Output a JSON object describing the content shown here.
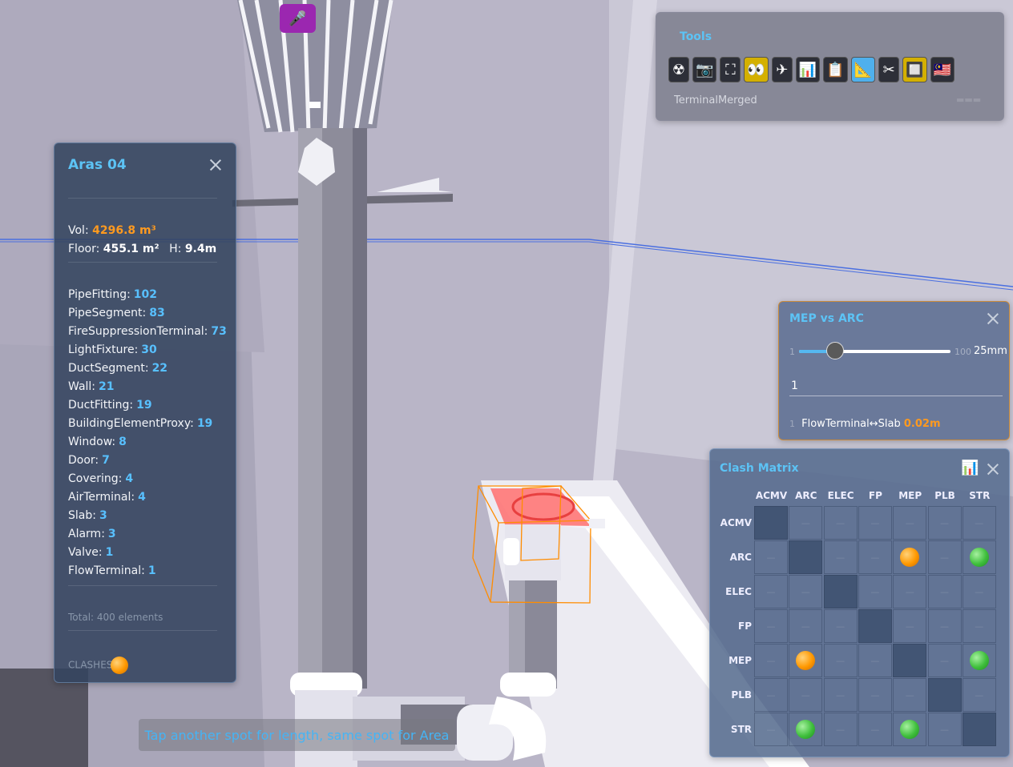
{
  "mic": {
    "icon": "🎤"
  },
  "info": {
    "title": "Aras 04",
    "vol_label": "Vol:",
    "vol_value": "4296.8 m³",
    "floor_label": "Floor:",
    "floor_value": "455.1 m²",
    "h_label": "H:",
    "h_value": "9.4m",
    "counts": [
      {
        "label": "PipeFitting:",
        "value": "102"
      },
      {
        "label": "PipeSegment:",
        "value": "83"
      },
      {
        "label": "FireSuppressionTerminal:",
        "value": "73"
      },
      {
        "label": "LightFixture:",
        "value": "30"
      },
      {
        "label": "DuctSegment:",
        "value": "22"
      },
      {
        "label": "Wall:",
        "value": "21"
      },
      {
        "label": "DuctFitting:",
        "value": "19"
      },
      {
        "label": "BuildingElementProxy:",
        "value": "19"
      },
      {
        "label": "Window:",
        "value": "8"
      },
      {
        "label": "Door:",
        "value": "7"
      },
      {
        "label": "Covering:",
        "value": "4"
      },
      {
        "label": "AirTerminal:",
        "value": "4"
      },
      {
        "label": "Slab:",
        "value": "3"
      },
      {
        "label": "Alarm:",
        "value": "3"
      },
      {
        "label": "Valve:",
        "value": "1"
      },
      {
        "label": "FlowTerminal:",
        "value": "1"
      }
    ],
    "total": "Total: 400 elements",
    "clashes_label": "CLASHES"
  },
  "tools": {
    "title": "Tools",
    "buttons": [
      {
        "icon": "☢",
        "name": "radiation-icon"
      },
      {
        "icon": "📷",
        "name": "camera-icon"
      },
      {
        "icon": "⛶",
        "name": "fullscreen-icon"
      },
      {
        "icon": "👀",
        "name": "eyes-icon"
      },
      {
        "icon": "✈",
        "name": "airplane-icon"
      },
      {
        "icon": "📊",
        "name": "bar-chart-icon"
      },
      {
        "icon": "📋",
        "name": "clipboard-icon"
      },
      {
        "icon": "📐",
        "name": "ruler-icon"
      },
      {
        "icon": "✂",
        "name": "scissors-icon"
      },
      {
        "icon": "🔲",
        "name": "frame-icon"
      },
      {
        "icon": "🇲🇾",
        "name": "malaysia-flag-icon"
      }
    ],
    "footer": "TerminalMerged"
  },
  "mep": {
    "title": "MEP vs ARC",
    "slider_min": "1",
    "slider_max": "100",
    "slider_value": "25mm",
    "slider_fraction": 0.24,
    "input_value": "1",
    "clash_index": "1",
    "clash_text": "FlowTerminal↔Slab",
    "clash_distance": "0.02m"
  },
  "matrix": {
    "title": "Clash Matrix",
    "chart_icon": "📊",
    "columns": [
      "ACMV",
      "ARC",
      "ELEC",
      "FP",
      "MEP",
      "PLB",
      "STR"
    ],
    "rows": [
      "ACMV",
      "ARC",
      "ELEC",
      "FP",
      "MEP",
      "PLB",
      "STR"
    ],
    "empty_symbol": "—",
    "cells": [
      [
        "",
        "",
        "",
        "",
        "",
        "",
        ""
      ],
      [
        "",
        "",
        "",
        "",
        "orange",
        "",
        "green"
      ],
      [
        "",
        "",
        "",
        "",
        "",
        "",
        ""
      ],
      [
        "",
        "",
        "",
        "",
        "",
        "",
        ""
      ],
      [
        "",
        "orange",
        "",
        "",
        "",
        "",
        "green"
      ],
      [
        "",
        "",
        "",
        "",
        "",
        "",
        ""
      ],
      [
        "",
        "green",
        "",
        "",
        "green",
        "",
        ""
      ]
    ]
  },
  "toast": "Tap another spot for length, same spot for Area",
  "colors": {
    "accent": "#5cc3f5",
    "orange": "#ff9a1f",
    "green": "#3fbf3c",
    "mic": "#9b27b0"
  }
}
